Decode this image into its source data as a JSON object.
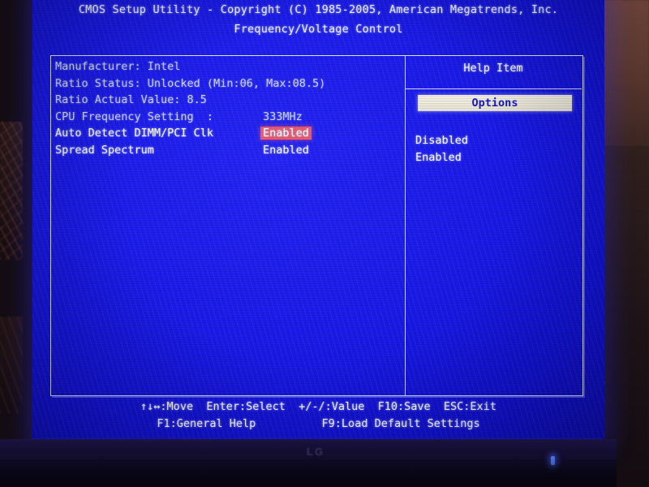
{
  "screen": {
    "title_line1": "CMOS Setup Utility - Copyright (C) 1985-2005, American Megatrends, Inc.",
    "title_line2": "Frequency/Voltage Control",
    "colors": {
      "background_blue": "#1a1ae8",
      "text_white": "#ffffff",
      "text_dim": "#ccd2f2",
      "highlight_red": "#ef5a68",
      "options_bar_bg": "#e8e4d4",
      "options_bar_text": "#1919c8",
      "border": "#dfe2ff"
    }
  },
  "main_panel": {
    "rows": [
      {
        "label": "Manufacturer: Intel",
        "value": "",
        "style": "dim",
        "selected": false
      },
      {
        "label": "Ratio Status: Unlocked (Min:06, Max:08.5)",
        "value": "",
        "style": "dim",
        "selected": false
      },
      {
        "label": "Ratio Actual Value: 8.5",
        "value": "",
        "style": "dim",
        "selected": false
      },
      {
        "label": "CPU Frequency Setting  :",
        "value": "333MHz",
        "style": "dim",
        "selected": false
      },
      {
        "label": "Auto Detect DIMM/PCI Clk",
        "value": "Enabled",
        "style": "bright",
        "selected": true
      },
      {
        "label": "Spread Spectrum",
        "value": "Enabled",
        "style": "bright",
        "selected": false
      }
    ]
  },
  "help_panel": {
    "header": "Help Item",
    "options_label": "Options",
    "options": [
      "Disabled",
      "Enabled"
    ]
  },
  "footer": {
    "line1": "↑↓↔:Move  Enter:Select  +/-/:Value  F10:Save  ESC:Exit",
    "line2": "F1:General Help          F9:Load Default Settings"
  },
  "monitor": {
    "brand_logo": "LG",
    "power_led": "power-led-blue"
  }
}
